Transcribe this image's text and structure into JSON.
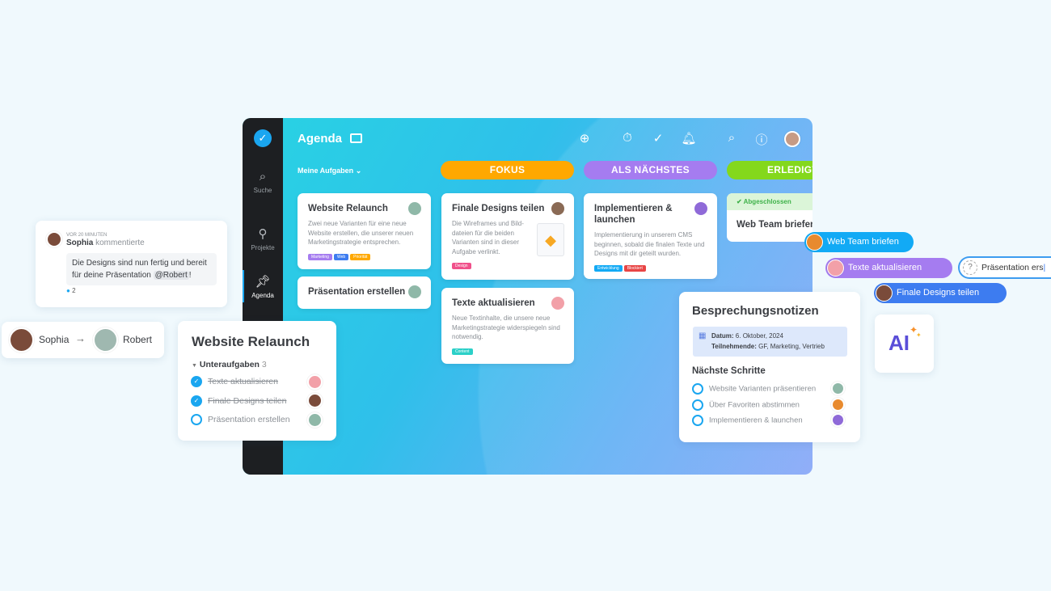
{
  "app": {
    "title": "Agenda",
    "filter": "Meine Aufgaben",
    "sidebar": [
      {
        "label": "Suche",
        "icon": "search-icon"
      },
      {
        "label": "Projekte",
        "icon": "rocket-icon"
      },
      {
        "label": "Agenda",
        "icon": "pin-icon",
        "active": true
      }
    ],
    "header_icons": [
      "plus-circle-icon",
      "stopwatch-icon",
      "check-circle-icon",
      "bell-icon",
      "search-icon",
      "help-icon",
      "avatar"
    ],
    "columns": [
      {
        "label": "FOKUS",
        "color": "#ffa800"
      },
      {
        "label": "ALS NÄCHSTES",
        "color": "#a57cf0"
      },
      {
        "label": "ERLEDIGT",
        "color": "#84d81c"
      }
    ],
    "cards": {
      "website": {
        "title": "Website Relaunch",
        "desc": "Zwei neue Varianten für eine neue Website erstellen, die unserer neuen Marketingstrategie entsprechen.",
        "tags": [
          "Marketing",
          "Web",
          "Priorität"
        ]
      },
      "praesentation": {
        "title": "Präsentation erstellen"
      },
      "finale": {
        "title": "Finale Designs teilen",
        "desc": "Die Wireframes und Bild-dateien für die beiden Varianten sind in dieser Aufgabe verlinkt.",
        "tags": [
          "Design"
        ]
      },
      "texte": {
        "title": "Texte aktualisieren",
        "desc": "Neue Textinhalte, die unsere neue Marketingstrategie widerspiegeln sind notwendig.",
        "tags": [
          "Content"
        ]
      },
      "implement": {
        "title": "Implementieren & launchen",
        "desc": "Implementierung in unserem CMS beginnen, sobald die finalen Texte und Designs mit dir geteilt wurden.",
        "tags": [
          "Entwicklung",
          "Blockiert"
        ]
      },
      "webteam": {
        "status": "Abgeschlossen",
        "title": "Web Team briefen"
      }
    }
  },
  "comment": {
    "time": "VOR 20 MINUTEN",
    "author": "Sophia",
    "action": "kommentierte",
    "text": "Die Designs sind nun fertig und bereit für deine Präsentation",
    "mention": "@Robert",
    "suffix": "!",
    "likes": "2"
  },
  "handoff": {
    "from": "Sophia",
    "arrow": "→",
    "to": "Robert"
  },
  "subtasks": {
    "title": "Website Relaunch",
    "section": "Unteraufgaben",
    "count": "3",
    "items": [
      {
        "label": "Texte aktualisieren",
        "done": true
      },
      {
        "label": "Finale Designs teilen",
        "done": true
      },
      {
        "label": "Präsentation erstellen",
        "done": false
      }
    ]
  },
  "notes": {
    "title": "Besprechungsnotizen",
    "date_label": "Datum:",
    "date": "6. Oktober, 2024",
    "people_label": "Teilnehmende:",
    "people": "GF, Marketing, Vertrieb",
    "steps_title": "Nächste Schritte",
    "steps": [
      "Website Varianten präsentieren",
      "Über Favoriten abstimmen",
      "Implementieren & launchen"
    ]
  },
  "pills": [
    {
      "label": "Web Team briefen",
      "color": "#12aaf5"
    },
    {
      "label": "Texte aktualisieren",
      "color": "#a57cf0"
    },
    {
      "label": "Finale Designs teilen",
      "color": "#3d7cf0"
    }
  ],
  "new_task_input": "Präsentation ers",
  "ai_badge": "AI"
}
